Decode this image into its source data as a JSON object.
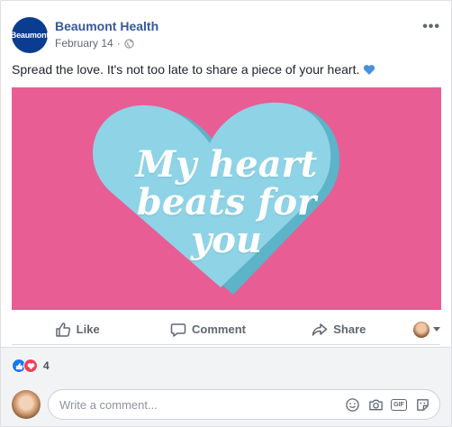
{
  "post": {
    "page_name": "Beaumont Health",
    "logo_text": "Beaumont",
    "date": "February 14",
    "more": "•••",
    "text": "Spread the love. It's not too late to share a piece of your heart.",
    "image_lines": [
      "My heart",
      "beats for",
      "you"
    ]
  },
  "colors": {
    "image_bg": "#e85d93",
    "heart": "#8fd3e6",
    "heart_shadow": "#5db3c7",
    "link": "#365899"
  },
  "actions": {
    "like": "Like",
    "comment": "Comment",
    "share": "Share"
  },
  "reactions": {
    "count": "4",
    "types": [
      "like-icon",
      "love-icon"
    ]
  },
  "comment": {
    "placeholder": "Write a comment..."
  }
}
